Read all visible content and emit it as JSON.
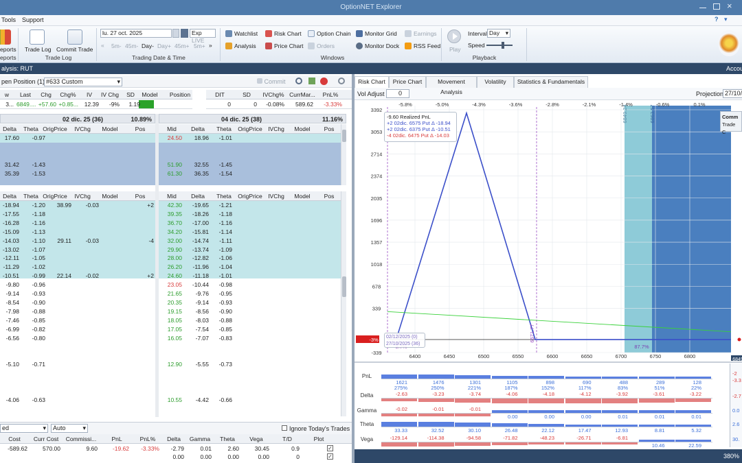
{
  "window": {
    "title": "OptionNET Explorer"
  },
  "menu": [
    "Tools",
    "Support"
  ],
  "ribbon": {
    "reports_label": "eports",
    "reports_group": "eports",
    "trade_log": "Trade Log",
    "commit_trade": "Commit Trade",
    "trade_log_group": "Trade Log",
    "date": "lu. 27 oct. 2025",
    "exp": "Exp",
    "live": "LIVE",
    "steps": [
      "5m-",
      "45m-",
      "Day-",
      "Day+",
      "45m+",
      "5m+"
    ],
    "date_group": "Trading Date & Time",
    "watchlist": "Watchlist",
    "risk_chart": "Risk Chart",
    "option_chain": "Option Chain",
    "monitor_grid": "Monitor Grid",
    "earnings": "Earnings",
    "analysis": "Analysis",
    "price_chart": "Price Chart",
    "orders": "Orders",
    "monitor_dock": "Monitor Dock",
    "rss_feed": "RSS Feed",
    "windows_group": "Windows",
    "play": "Play",
    "interval_label": "Interval",
    "interval": "Day",
    "speed_label": "Speed",
    "playback_group": "Playback"
  },
  "analysis_bar": {
    "left": "alysis: RUT",
    "right": "Accou"
  },
  "left": {
    "position_label": "pen Position (1)",
    "position_select": "#633 Custom",
    "commit": "Commit",
    "summary_headers": [
      "w",
      "Last",
      "Chg",
      "Chg%",
      "IV",
      "IV Chg",
      "SD",
      "Model",
      "Position"
    ],
    "summary_values": [
      "3...",
      "6849....",
      "+57.60",
      "+0.85...",
      "12.39",
      "-9%",
      "1.19",
      "",
      ""
    ],
    "dit_headers": [
      "DIT",
      "SD",
      "IVChg%",
      "CurrMar...",
      "PnL%"
    ],
    "dit_values": [
      "0",
      "0",
      "-0.08%",
      "589.62",
      "-3.33%"
    ],
    "exp1": {
      "label": "02 dic. 25 (36)",
      "pct": "10.89%"
    },
    "exp2": {
      "label": "04 dic. 25 (38)",
      "pct": "11.16%"
    },
    "call_headers_l": [
      "Delta",
      "Theta",
      "OrigPrice",
      "IVChg",
      "Model",
      "Pos"
    ],
    "call_headers_r": [
      "Mid",
      "Delta",
      "Theta",
      "OrigPrice",
      "IVChg",
      "Model",
      "Pos"
    ],
    "call_rows": [
      {
        "ld": "17.60",
        "lt": "-0.97",
        "rm": "24.50",
        "rd": "18.96",
        "rt": "-1.01"
      },
      {
        "ld": "",
        "lt": "",
        "rm": "",
        "rd": "",
        "rt": ""
      },
      {
        "ld": "",
        "lt": "",
        "rm": "",
        "rd": "",
        "rt": ""
      },
      {
        "ld": "31.42",
        "lt": "-1.43",
        "rm": "51.90",
        "rd": "32.55",
        "rt": "-1.45"
      },
      {
        "ld": "35.39",
        "lt": "-1.53",
        "rm": "61.30",
        "rd": "36.35",
        "rt": "-1.54"
      }
    ],
    "put_headers_l": [
      "Delta",
      "Theta",
      "OrigPrice",
      "IVChg",
      "Model",
      "Pos"
    ],
    "put_headers_r": [
      "Mid",
      "Delta",
      "Theta",
      "OrigPrice",
      "IVChg",
      "Model",
      "Pos"
    ],
    "put_rows": [
      {
        "ld": "-18.94",
        "lt": "-1.20",
        "lo": "38.99",
        "li": "-0.03",
        "lp": "+2",
        "rm": "42.30",
        "rd": "-19.65",
        "rt": "-1.21"
      },
      {
        "ld": "-17.55",
        "lt": "-1.18",
        "lo": "",
        "li": "",
        "lp": "",
        "rm": "39.35",
        "rd": "-18.26",
        "rt": "-1.18"
      },
      {
        "ld": "-16.28",
        "lt": "-1.16",
        "lo": "",
        "li": "",
        "lp": "",
        "rm": "36.70",
        "rd": "-17.00",
        "rt": "-1.16"
      },
      {
        "ld": "-15.09",
        "lt": "-1.13",
        "lo": "",
        "li": "",
        "lp": "",
        "rm": "34.20",
        "rd": "-15.81",
        "rt": "-1.14"
      },
      {
        "ld": "-14.03",
        "lt": "-1.10",
        "lo": "29.11",
        "li": "-0.03",
        "lp": "-4",
        "rm": "32.00",
        "rd": "-14.74",
        "rt": "-1.11"
      },
      {
        "ld": "-13.02",
        "lt": "-1.07",
        "lo": "",
        "li": "",
        "lp": "",
        "rm": "29.90",
        "rd": "-13.74",
        "rt": "-1.09"
      },
      {
        "ld": "-12.11",
        "lt": "-1.05",
        "lo": "",
        "li": "",
        "lp": "",
        "rm": "28.00",
        "rd": "-12.82",
        "rt": "-1.06"
      },
      {
        "ld": "-11.29",
        "lt": "-1.02",
        "lo": "",
        "li": "",
        "lp": "",
        "rm": "26.20",
        "rd": "-11.96",
        "rt": "-1.04"
      },
      {
        "ld": "-10.51",
        "lt": "-0.99",
        "lo": "22.14",
        "li": "-0.02",
        "lp": "+2",
        "rm": "24.60",
        "rd": "-11.18",
        "rt": "-1.01"
      },
      {
        "ld": "-9.80",
        "lt": "-0.96",
        "lo": "",
        "li": "",
        "lp": "",
        "rm": "23.05",
        "rd": "-10.44",
        "rt": "-0.98"
      },
      {
        "ld": "-9.14",
        "lt": "-0.93",
        "lo": "",
        "li": "",
        "lp": "",
        "rm": "21.65",
        "rd": "-9.76",
        "rt": "-0.95"
      },
      {
        "ld": "-8.54",
        "lt": "-0.90",
        "lo": "",
        "li": "",
        "lp": "",
        "rm": "20.35",
        "rd": "-9.14",
        "rt": "-0.93"
      },
      {
        "ld": "-7.98",
        "lt": "-0.88",
        "lo": "",
        "li": "",
        "lp": "",
        "rm": "19.15",
        "rd": "-8.56",
        "rt": "-0.90"
      },
      {
        "ld": "-7.46",
        "lt": "-0.85",
        "lo": "",
        "li": "",
        "lp": "",
        "rm": "18.05",
        "rd": "-8.03",
        "rt": "-0.88"
      },
      {
        "ld": "-6.99",
        "lt": "-0.82",
        "lo": "",
        "li": "",
        "lp": "",
        "rm": "17.05",
        "rd": "-7.54",
        "rt": "-0.85"
      },
      {
        "ld": "-6.56",
        "lt": "-0.80",
        "lo": "",
        "li": "",
        "lp": "",
        "rm": "16.05",
        "rd": "-7.07",
        "rt": "-0.83"
      },
      {
        "ld": "",
        "lt": "",
        "lo": "",
        "li": "",
        "lp": "",
        "rm": "",
        "rd": "",
        "rt": ""
      },
      {
        "ld": "",
        "lt": "",
        "lo": "",
        "li": "",
        "lp": "",
        "rm": "",
        "rd": "",
        "rt": ""
      },
      {
        "ld": "-5.10",
        "lt": "-0.71",
        "lo": "",
        "li": "",
        "lp": "",
        "rm": "12.90",
        "rd": "-5.55",
        "rt": "-0.73"
      },
      {
        "ld": "",
        "lt": "",
        "lo": "",
        "li": "",
        "lp": "",
        "rm": "",
        "rd": "",
        "rt": ""
      },
      {
        "ld": "",
        "lt": "",
        "lo": "",
        "li": "",
        "lp": "",
        "rm": "",
        "rd": "",
        "rt": ""
      },
      {
        "ld": "",
        "lt": "",
        "lo": "",
        "li": "",
        "lp": "",
        "rm": "",
        "rd": "",
        "rt": ""
      },
      {
        "ld": "-4.06",
        "lt": "-0.63",
        "lo": "",
        "li": "",
        "lp": "",
        "rm": "10.55",
        "rd": "-4.42",
        "rt": "-0.66"
      }
    ],
    "bottom": {
      "select1": "ed",
      "select2": "Auto",
      "ignore_label": "Ignore Today's Trades",
      "headers": [
        "Cost",
        "Curr Cost",
        "Commissi...",
        "PnL",
        "PnL%",
        "Delta",
        "Gamma",
        "Theta",
        "Vega",
        "T/D",
        "Plot"
      ],
      "row1": [
        "-589.62",
        "570.00",
        "9.60",
        "-19.62",
        "-3.33%",
        "-2.79",
        "0.01",
        "2.60",
        "30.45",
        "0.9"
      ],
      "row2": [
        "",
        "",
        "",
        "",
        "",
        "0.00",
        "0.00",
        "0.00",
        "0.00",
        "0"
      ]
    }
  },
  "right": {
    "tabs": [
      "Risk Chart",
      "Price Chart",
      "Movement Analysis",
      "Volatility",
      "Statistics & Fundamentals"
    ],
    "vol_adjust_label": "Vol Adjust",
    "vol_adjust": "0",
    "projection_label": "Projection",
    "projection": "27/10/",
    "top_pct": [
      "-5.8%",
      "-5.0%",
      "-4.3%",
      "-3.6%",
      "-2.8%",
      "-2.1%",
      "-1.4%",
      "-0.6%",
      "0.1%"
    ],
    "legend": {
      "realized": "-9.60 Realized PnL",
      "l1": "+2 02dic. 6575 Put Δ  -18.94",
      "l2": "+2 02dic. 6375 Put Δ  -10.51",
      "l3": "-4 02dic. 6475 Put Δ  -14.03"
    },
    "comm_box": [
      "Comm",
      "Trade C"
    ],
    "date_box": [
      "02/12/2025 (0)",
      "27/10/2025 (36)"
    ],
    "markers": {
      "m1": "9.7%",
      "m2": "87.7%",
      "m3": "-3%",
      "current": "6849",
      "v1": "6671.77",
      "v2": "6849.24",
      "v3": "6863.57"
    },
    "footer_pct": "380%",
    "greeks": {
      "labels": [
        "PnL",
        "Delta",
        "Gamma",
        "Theta",
        "Vega"
      ],
      "pnl": [
        "1621",
        "1476",
        "1301",
        "1105",
        "898",
        "690",
        "488",
        "289",
        "128"
      ],
      "pnl_pct": [
        "275%",
        "250%",
        "221%",
        "187%",
        "152%",
        "117%",
        "83%",
        "51%",
        "22%"
      ],
      "delta": [
        "-2.63",
        "-3.23",
        "-3.74",
        "-4.06",
        "-4.18",
        "-4.12",
        "-3.92",
        "-3.61",
        "-3.22"
      ],
      "gamma": [
        "-0.02",
        "-0.01",
        "-0.01",
        "0.00",
        "0.00",
        "0.00",
        "0.01",
        "0.01",
        "0.01"
      ],
      "theta": [
        "33.33",
        "32.52",
        "30.10",
        "26.48",
        "22.12",
        "17.47",
        "12.93",
        "8.81",
        "5.32"
      ],
      "vega": [
        "-129.14",
        "-114.38",
        "-94.58",
        "-71.82",
        "-48.23",
        "-26.71",
        "-6.81",
        "10.46",
        "22.59"
      ],
      "right_edge": [
        "-2",
        "-3.3",
        "-2.7",
        "0.0",
        "2.6",
        "30."
      ]
    }
  },
  "chart_data": {
    "type": "line",
    "x_ticks": [
      "6400",
      "6450",
      "6500",
      "6550",
      "6600",
      "6650",
      "6700",
      "6750",
      "6800"
    ],
    "y_ticks": [
      "3392",
      "3053",
      "2714",
      "2374",
      "2035",
      "1696",
      "1357",
      "1018",
      "678",
      "339",
      "-339"
    ],
    "xlim": [
      6360,
      6860
    ],
    "ylim": [
      -339,
      3392
    ],
    "series": [
      {
        "color": "#3b4fc9",
        "x": [
          6375,
          6475,
          6575,
          6860
        ],
        "y": [
          -59,
          3341,
          -139,
          -139
        ]
      },
      {
        "color": "#39d13a",
        "x": [
          6360,
          6860
        ],
        "y": [
          290,
          -19
        ]
      }
    ]
  }
}
